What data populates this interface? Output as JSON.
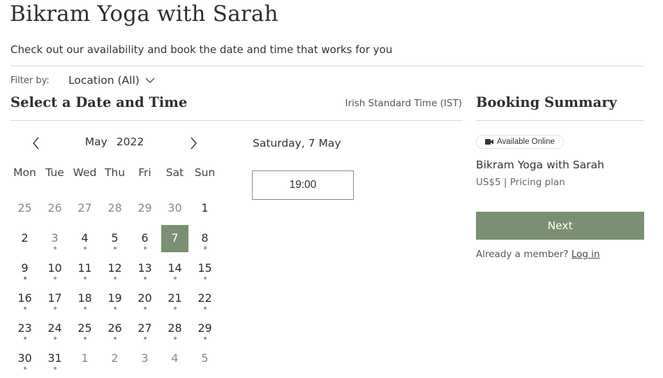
{
  "page": {
    "title": "Bikram Yoga with Sarah",
    "subtitle": "Check out our availability and book the date and time that works for you"
  },
  "filter": {
    "label": "Filter by:",
    "value": "Location (All)"
  },
  "scheduler": {
    "section_title": "Select a Date and Time",
    "timezone": "Irish Standard Time (IST)",
    "calendar": {
      "month": "May",
      "year": "2022",
      "weekdays": [
        "Mon",
        "Tue",
        "Wed",
        "Thu",
        "Fri",
        "Sat",
        "Sun"
      ],
      "accent_color": "#7b8f72",
      "days": [
        {
          "label": "25",
          "current_month": false,
          "available": false
        },
        {
          "label": "26",
          "current_month": false,
          "available": false
        },
        {
          "label": "27",
          "current_month": false,
          "available": false
        },
        {
          "label": "28",
          "current_month": false,
          "available": false
        },
        {
          "label": "29",
          "current_month": false,
          "available": false
        },
        {
          "label": "30",
          "current_month": false,
          "available": false
        },
        {
          "label": "1",
          "current_month": true,
          "available": false
        },
        {
          "label": "2",
          "current_month": true,
          "available": false
        },
        {
          "label": "3",
          "current_month": true,
          "available": true,
          "today": true
        },
        {
          "label": "4",
          "current_month": true,
          "available": true
        },
        {
          "label": "5",
          "current_month": true,
          "available": true
        },
        {
          "label": "6",
          "current_month": true,
          "available": true
        },
        {
          "label": "7",
          "current_month": true,
          "available": true,
          "selected": true
        },
        {
          "label": "8",
          "current_month": true,
          "available": true
        },
        {
          "label": "9",
          "current_month": true,
          "available": true,
          "highlight_dot": true
        },
        {
          "label": "10",
          "current_month": true,
          "available": true
        },
        {
          "label": "11",
          "current_month": true,
          "available": true
        },
        {
          "label": "12",
          "current_month": true,
          "available": true
        },
        {
          "label": "13",
          "current_month": true,
          "available": true
        },
        {
          "label": "14",
          "current_month": true,
          "available": true
        },
        {
          "label": "15",
          "current_month": true,
          "available": true
        },
        {
          "label": "16",
          "current_month": true,
          "available": true
        },
        {
          "label": "17",
          "current_month": true,
          "available": true
        },
        {
          "label": "18",
          "current_month": true,
          "available": true
        },
        {
          "label": "19",
          "current_month": true,
          "available": true
        },
        {
          "label": "20",
          "current_month": true,
          "available": true
        },
        {
          "label": "21",
          "current_month": true,
          "available": true
        },
        {
          "label": "22",
          "current_month": true,
          "available": true
        },
        {
          "label": "23",
          "current_month": true,
          "available": true
        },
        {
          "label": "24",
          "current_month": true,
          "available": true
        },
        {
          "label": "25",
          "current_month": true,
          "available": true
        },
        {
          "label": "26",
          "current_month": true,
          "available": true
        },
        {
          "label": "27",
          "current_month": true,
          "available": true
        },
        {
          "label": "28",
          "current_month": true,
          "available": true
        },
        {
          "label": "29",
          "current_month": true,
          "available": true
        },
        {
          "label": "30",
          "current_month": true,
          "available": true
        },
        {
          "label": "31",
          "current_month": true,
          "available": true
        },
        {
          "label": "1",
          "current_month": false,
          "available": false
        },
        {
          "label": "2",
          "current_month": false,
          "available": false
        },
        {
          "label": "3",
          "current_month": false,
          "available": false
        },
        {
          "label": "4",
          "current_month": false,
          "available": false
        },
        {
          "label": "5",
          "current_month": false,
          "available": false
        }
      ]
    },
    "selected_date_label": "Saturday, 7 May",
    "time_slots": [
      "19:00"
    ]
  },
  "summary": {
    "title": "Booking Summary",
    "badge": {
      "icon": "video-camera-icon",
      "label": "Available Online"
    },
    "service_name": "Bikram Yoga with Sarah",
    "price_line": "US$5 | Pricing plan",
    "next_label": "Next",
    "member_prompt": "Already a member?",
    "login_label": "Log in"
  }
}
